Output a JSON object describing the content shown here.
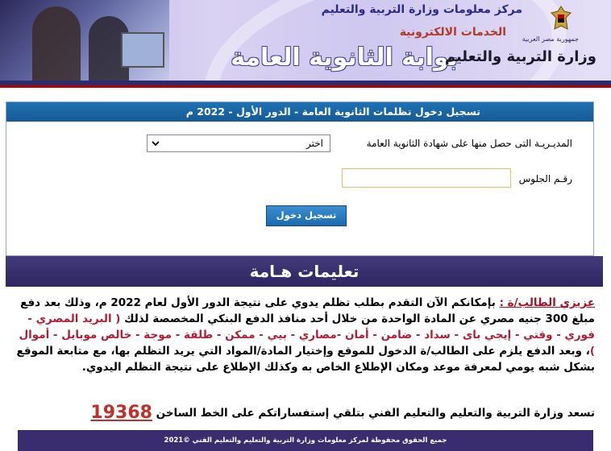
{
  "header": {
    "center_name": "مركز معلومات وزارة التربية والتعليم",
    "e_services": "الخدمات الالكترونية",
    "portal_title": "بوابة الثانوية العامة",
    "ministry_small": "جمهورية مصر العربية",
    "ministry_name": "وزارة التربية والتعليم",
    "emblem_icon": "egypt-eagle-emblem-icon"
  },
  "form": {
    "title": "تسجيل دخول تظلمات الثانوية العامة - الدور الأول - 2022 م",
    "directorate_label": "المديـريـة التى حصل منها على شهادة الثانوية العامة",
    "directorate_selected": "اختر",
    "seat_label": "رقـم الجلوس",
    "seat_value": "",
    "submit_label": "تسجيل دخول"
  },
  "notes": {
    "title": "تعليمات هـامة",
    "dear": "عزيزي الطالب/ة :",
    "p1": " بإمكانكم الآن التقدم بطلب تظلم يدوي على نتيجة الدور الأول لعام 2022 م، وذلك بعد دفع مبلغ 300 جنيه مصري عن المادة الواحدة من خلال أحد منافذ الدفع البنكي المخصصة لذلك ",
    "methods": "( البريد المصري - فوري - وقتي - إيجي باى - سداد - ضامن - أمان -مصاري - بيي - ممكن - طلقة - موجة - خالص موبايل - أموال )",
    "p2": "، وبعد الدفع يلزم على الطالب/ة الدخول للموقع وإختيار المادة/المواد التي يريد التظلم بها، مع متابعة الموقع بشكل شبه يومي لمعرفة موعد ومكان الإطلاع الخاص به وكذلك الإطلاع على نتيجة التظلم اليدوي.",
    "hotline_text": "تسعد وزارة التربية والتعليم والتعليم الفني بتلقي إستفساراتكم على الخط الساخن",
    "hotline_number": "19368"
  },
  "footer": {
    "text": "جميع الحقوق محفوظة لمركز معلومات وزارة التربية والتعليم والتعليم الفني ©2021"
  }
}
